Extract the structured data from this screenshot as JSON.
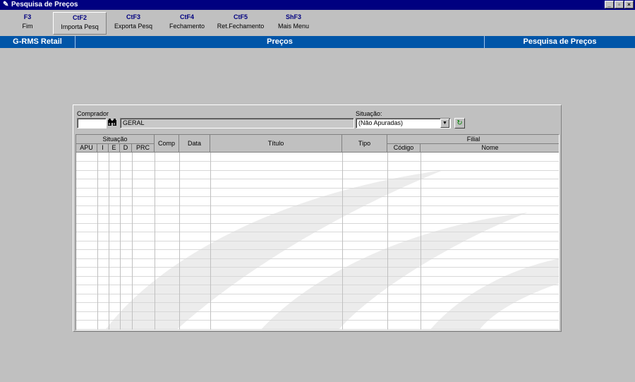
{
  "window": {
    "title": "Pesquisa de Preços",
    "buttons": [
      "_",
      "▫",
      "×"
    ]
  },
  "toolbar": {
    "items": [
      {
        "key": "F3",
        "label": "Fim"
      },
      {
        "key": "CtF2",
        "label": "Importa Pesq"
      },
      {
        "key": "CtF3",
        "label": "Exporta Pesq"
      },
      {
        "key": "CtF4",
        "label": "Fechamento"
      },
      {
        "key": "CtF5",
        "label": "Ret.Fechamento"
      },
      {
        "key": "ShF3",
        "label": "Mais Menu"
      }
    ]
  },
  "banner": {
    "app": "G-RMS Retail",
    "module": "Preços",
    "screen": "Pesquisa de Preços"
  },
  "form": {
    "comprador_label": "Comprador",
    "comprador_value": "",
    "comprador_name": "GERAL",
    "situacao_label": "Situação:",
    "situacao_value": "(Não Apuradas)"
  },
  "grid": {
    "group_situacao": "Situação",
    "group_filial": "Filial",
    "col_apu": "APU",
    "col_i": "I",
    "col_e": "E",
    "col_d": "D",
    "col_prc": "PRC",
    "col_comp": "Comp",
    "col_data": "Data",
    "col_titulo": "Título",
    "col_tipo": "Tipo",
    "col_codigo": "Código",
    "col_nome": "Nome",
    "rows": []
  },
  "colors": {
    "titlebar": "#000080",
    "banner": "#0055a8",
    "background": "#c0c0c0"
  },
  "icons": {
    "search": "binoculars-icon",
    "refresh": "refresh-icon",
    "app": "pen-icon"
  }
}
